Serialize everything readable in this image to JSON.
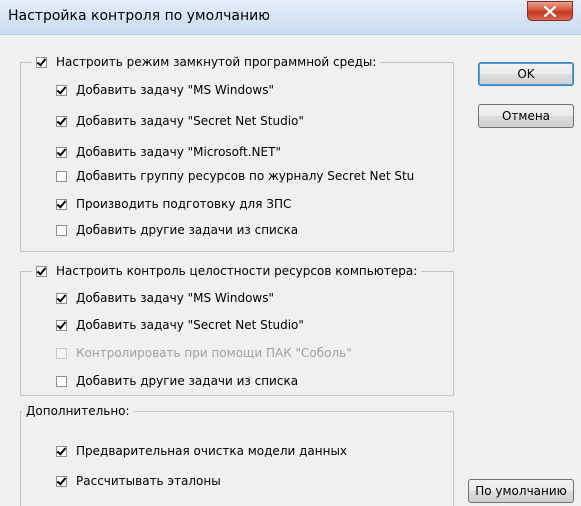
{
  "window": {
    "title": "Настройка контроля по умолчанию"
  },
  "group_ips": {
    "header": "Настроить режим замкнутой программной среды:",
    "header_checked": true,
    "items": [
      {
        "label": "Добавить задачу \"MS Windows\"",
        "checked": true,
        "disabled": false
      },
      {
        "label": "Добавить задачу \"Secret Net Studio\"",
        "checked": true,
        "disabled": false
      },
      {
        "label": "Добавить задачу \"Microsoft.NET\"",
        "checked": true,
        "disabled": false
      },
      {
        "label": "Добавить группу ресурсов по журналу Secret Net Stu",
        "checked": false,
        "disabled": false
      },
      {
        "label": "Производить подготовку для ЗПС",
        "checked": true,
        "disabled": false
      },
      {
        "label": "Добавить другие задачи из списка",
        "checked": false,
        "disabled": false
      }
    ]
  },
  "group_integrity": {
    "header": "Настроить контроль целостности ресурсов компьютера:",
    "header_checked": true,
    "items": [
      {
        "label": "Добавить задачу \"MS Windows\"",
        "checked": true,
        "disabled": false
      },
      {
        "label": "Добавить задачу \"Secret Net Studio\"",
        "checked": true,
        "disabled": false
      },
      {
        "label": "Контролировать при помощи ПАК \"Соболь\"",
        "checked": false,
        "disabled": true
      },
      {
        "label": "Добавить другие задачи из списка",
        "checked": false,
        "disabled": false
      }
    ]
  },
  "group_extra": {
    "header": "Дополнительно:",
    "items": [
      {
        "label": "Предварительная очистка модели данных",
        "checked": true,
        "disabled": false
      },
      {
        "label": "Рассчитывать эталоны",
        "checked": true,
        "disabled": false
      }
    ]
  },
  "buttons": {
    "ok": "OK",
    "cancel": "Отмена",
    "defaults": "По умолчанию"
  },
  "icons": {
    "close": "close-icon"
  },
  "colors": {
    "close_button": "#c4371f",
    "title_bar": "#d6e4f4",
    "dialog_background": "#f0f0f0",
    "default_button_border": "#3c7fb1"
  }
}
